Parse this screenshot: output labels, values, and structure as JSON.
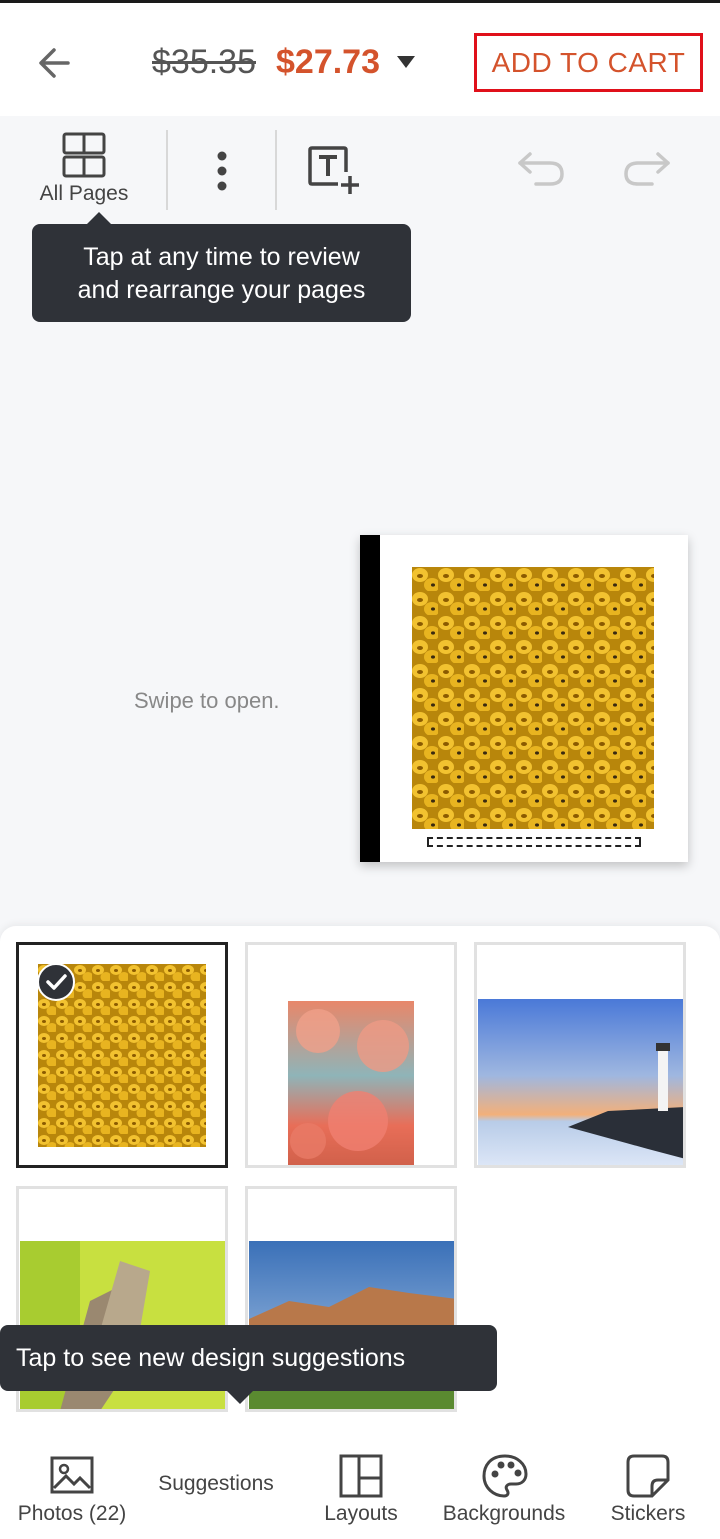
{
  "header": {
    "old_price": "$35.35",
    "new_price": "$27.73",
    "cart_label": "ADD TO CART",
    "cart_border_color": "#e0101a",
    "price_color": "#d4532c"
  },
  "toolbar": {
    "all_pages_label": "All Pages",
    "icons": [
      "grid-icon",
      "more-vertical-icon",
      "add-text-icon",
      "undo-icon",
      "redo-icon"
    ]
  },
  "tooltips": {
    "pages_line1": "Tap at any time to review",
    "pages_line2": "and rearrange your pages",
    "suggestions": "Tap to see new design suggestions"
  },
  "canvas": {
    "swipe_hint": "Swipe to open."
  },
  "nav": {
    "items": [
      {
        "label": "Photos (22)",
        "icon": "photo-icon"
      },
      {
        "label": "Suggestions",
        "icon": ""
      },
      {
        "label": "Layouts",
        "icon": "layout-icon"
      },
      {
        "label": "Backgrounds",
        "icon": "palette-icon"
      },
      {
        "label": "Stickers",
        "icon": "sticker-icon"
      }
    ]
  }
}
